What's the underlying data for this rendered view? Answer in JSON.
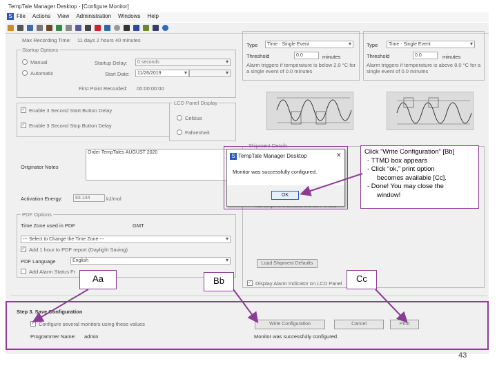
{
  "window": {
    "title": "TempTale Manager Desktop - [Configure Monitor]"
  },
  "menu": [
    "File",
    "Actions",
    "View",
    "Administration",
    "Windows",
    "Help"
  ],
  "max_recording": {
    "label": "Max Recording Time:",
    "value": "11 days 2 hours 40 minutes"
  },
  "startup": {
    "title": "Startup Options",
    "manual": "Manual",
    "automatic": "Automatic",
    "delay_label": "Startup Delay:",
    "delay_value": "0 seconds",
    "date_label": "Start Date:",
    "date_value": "11/26/2019",
    "first_point_label": "First Point Recorded:",
    "first_point_value": "00:00:00:00"
  },
  "buttons_opts": {
    "start": "Enable 3 Second Start Button Delay",
    "stop": "Enable 3 Second Stop Button Delay"
  },
  "lcd": {
    "title": "LCD Panel Display",
    "celsius": "Celsius",
    "fahrenheit": "Fahrenheit"
  },
  "originator": {
    "label": "Originator Notes",
    "value": "Order TempTales AUGUST 2020"
  },
  "activation": {
    "label": "Activation Energy:",
    "value": "83.144",
    "unit": "kJ/mol"
  },
  "pdf": {
    "title": "PDF Options",
    "tz_label": "Time Zone used in PDF",
    "tz_value": "GMT",
    "tz_select": "--- Select to Change the Time Zone ---",
    "add_hour": "Add 1 hour to PDF report (Daylight Saving)",
    "lang_label": "PDF Language",
    "lang_value": "English",
    "alarm_status": "Add Alarm Status Fr"
  },
  "alarm_left": {
    "type_label": "Type",
    "type_value": "Time - Single Event",
    "threshold_label": "Threshold",
    "threshold_value": "0.0",
    "threshold_unit": "minutes",
    "desc": "Alarm triggers if temperature is below 2.0 °C for a single event of 0.0 minutes"
  },
  "alarm_right": {
    "type_label": "Type",
    "type_value": "Time - Single Event",
    "threshold_label": "Threshold",
    "threshold_value": "0.0",
    "threshold_unit": "minutes",
    "desc": "Alarm triggers if temperature is above 8.0 °C for a single event of 0.0 minutes"
  },
  "shipment": {
    "title": "Shipment Details",
    "partial": "No Shipment Details will be Printed",
    "load_button": "Load Shipment Defaults",
    "display_alarm": "Display Alarm Indicator on LCD Panel"
  },
  "step3": {
    "title": "Step 3. Save Configuration",
    "several": "Configure several monitors using these values",
    "programmer_label": "Programmer Name:",
    "programmer_value": "admin",
    "write_button": "Write Configuration",
    "cancel_button": "Cancel",
    "print_button": "Print",
    "status": "Monitor was successfully configured."
  },
  "dialog": {
    "title": "TempTale Manager Desktop",
    "message": "Monitor was successfully configured.",
    "ok": "OK",
    "close": "✕"
  },
  "callout_lines": [
    "Click “Write Configuration” [Bb]",
    "-  TTMD box appears",
    "-  Click “ok,” print option",
    "    becomes available [Cc].",
    "-  Done! You may close the",
    "    window!"
  ],
  "marks": {
    "aa": "Aa",
    "bb": "Bb",
    "cc": "Cc"
  },
  "page_number": "43",
  "colors": {
    "accent": "#8b3c95"
  }
}
